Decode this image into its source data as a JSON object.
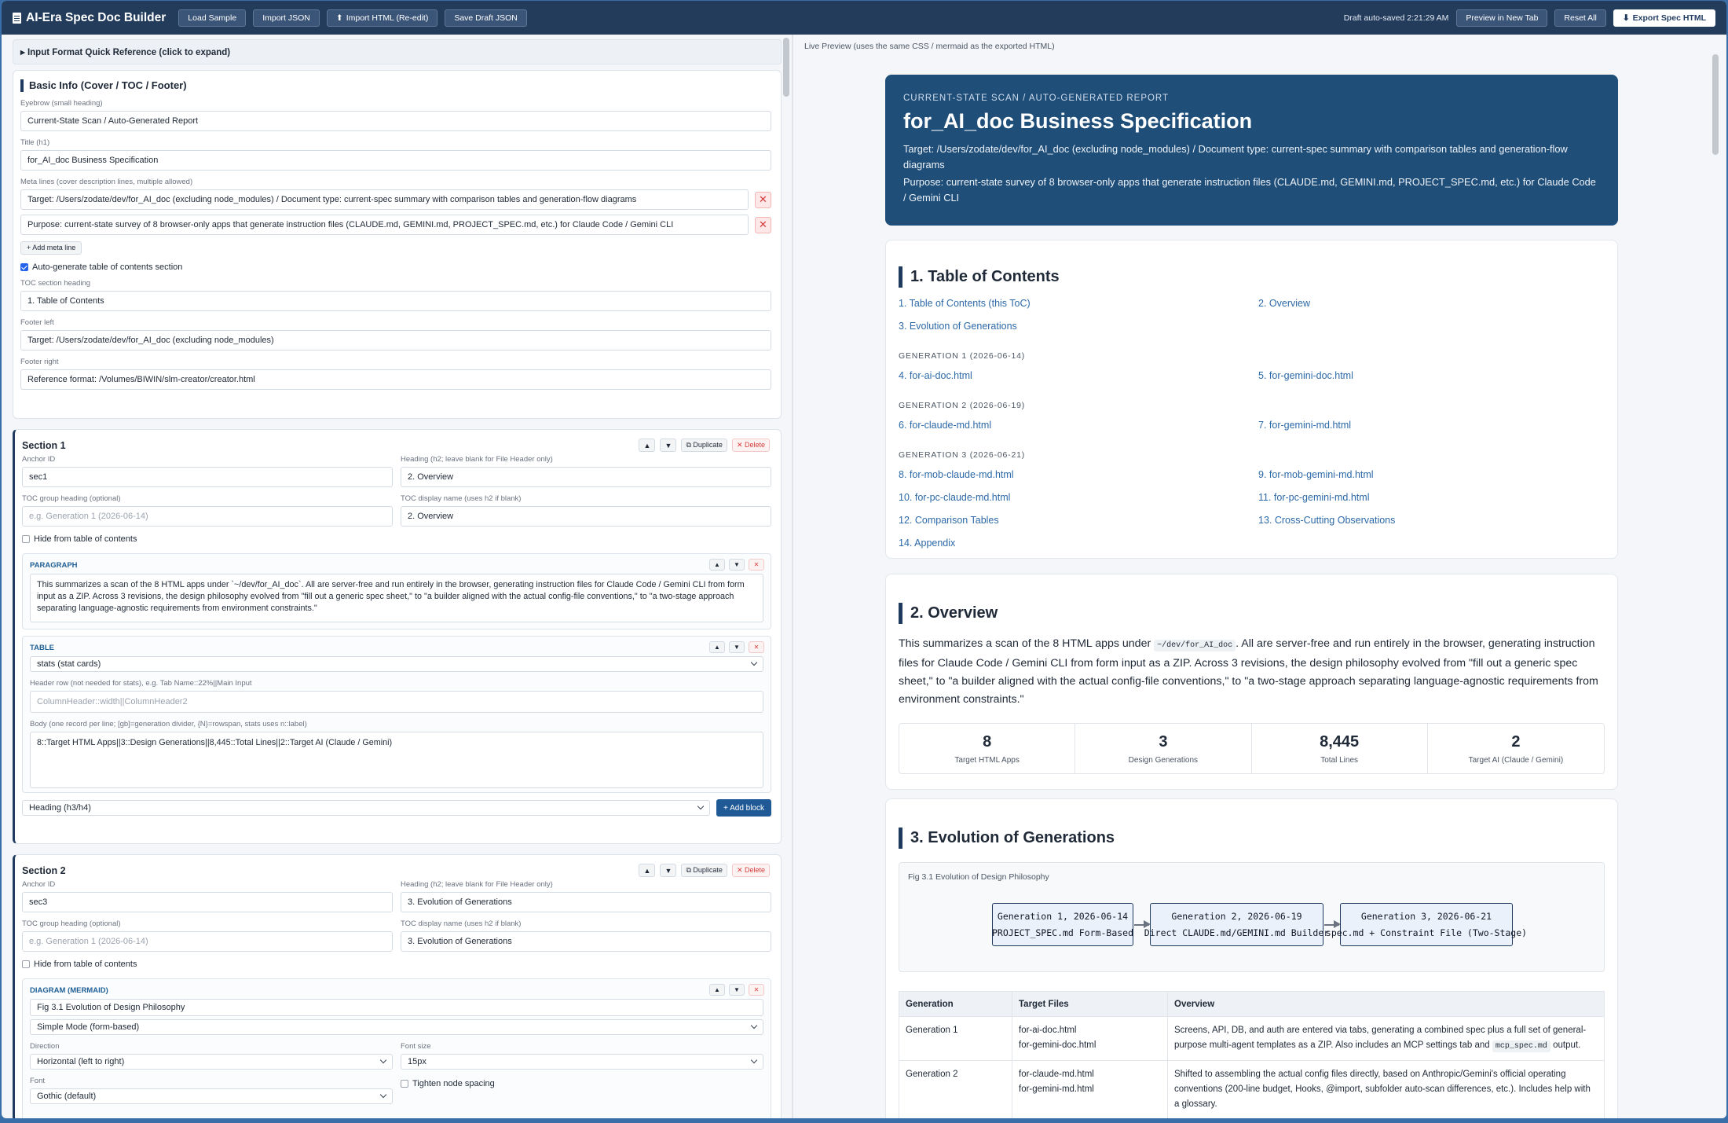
{
  "topbar": {
    "title": "AI-Era Spec Doc Builder",
    "buttons": [
      "Load Sample",
      "Import JSON",
      "Import HTML (Re-edit)",
      "Save Draft JSON"
    ],
    "saved": "Draft auto-saved 2:21:29 AM",
    "preview_tab": "Preview in New Tab",
    "reset": "Reset All",
    "export": "Export Spec HTML"
  },
  "editor": {
    "quick_ref": "▸ Input Format Quick Reference (click to expand)",
    "basic": {
      "title": "Basic Info (Cover / TOC / Footer)",
      "eyebrow_label": "Eyebrow (small heading)",
      "eyebrow": "Current-State Scan / Auto-Generated Report",
      "title_label": "Title (h1)",
      "title_value": "for_AI_doc Business Specification",
      "meta_label": "Meta lines (cover description lines, multiple allowed)",
      "meta": [
        "Target: /Users/zodate/dev/for_AI_doc (excluding node_modules) / Document type: current-spec summary with comparison tables and generation-flow diagrams",
        "Purpose: current-state survey of 8 browser-only apps that generate instruction files (CLAUDE.md, GEMINI.md, PROJECT_SPEC.md, etc.) for Claude Code / Gemini CLI"
      ],
      "add_meta": "+ Add meta line",
      "auto_toc": "Auto-generate table of contents section",
      "toc_heading_label": "TOC section heading",
      "toc_heading": "1. Table of Contents",
      "footer_left_label": "Footer left",
      "footer_left": "Target: /Users/zodate/dev/for_AI_doc (excluding node_modules)",
      "footer_right_label": "Footer right",
      "footer_right": "Reference format: /Volumes/BIWIN/slm-creator/creator.html"
    },
    "common": {
      "anchor_label": "Anchor ID",
      "heading_label": "Heading (h2; leave blank for File Header only)",
      "toc_group_label": "TOC group heading (optional)",
      "toc_group_ph": "e.g. Generation 1 (2026-06-14)",
      "toc_display_label": "TOC display name (uses h2 if blank)",
      "hide_toc": "Hide from table of contents",
      "duplicate": "⧉ Duplicate",
      "delete": "✕ Delete",
      "up": "▲",
      "down": "▼",
      "x": "✕",
      "add_block": "+ Add block",
      "block_type": "Heading (h3/h4)"
    },
    "s1": {
      "title": "Section 1",
      "anchor": "sec1",
      "heading": "2. Overview",
      "toc_display": "2. Overview",
      "p_label": "PARAGRAPH",
      "p_text": "This summarizes a scan of the 8 HTML apps under `~/dev/for_AI_doc`. All are server-free and run entirely in the browser, generating instruction files for Claude Code / Gemini CLI from form input as a ZIP. Across 3 revisions, the design philosophy evolved from \"fill out a generic spec sheet,\" to \"a builder aligned with the actual config-file conventions,\" to \"a two-stage approach separating language-agnostic requirements from environment constraints.\"",
      "t_label": "TABLE",
      "t_type": "stats (stat cards)",
      "header_label": "Header row (not needed for stats), e.g. Tab Name::22%||Main Input",
      "header_ph": "ColumnHeader::width||ColumnHeader2",
      "body_label": "Body (one record per line; [gb]=generation divider, {N}=rowspan, stats uses n::label)",
      "body_text": "8::Target HTML Apps||3::Design Generations||8,445::Total Lines||2::Target AI (Claude / Gemini)"
    },
    "s2": {
      "title": "Section 2",
      "anchor": "sec3",
      "heading": "3. Evolution of Generations",
      "toc_display": "3. Evolution of Generations",
      "d_label": "DIAGRAM (MERMAID)",
      "d_caption": "Fig 3.1 Evolution of Design Philosophy",
      "d_mode": "Simple Mode (form-based)",
      "dir_label": "Direction",
      "dir": "Horizontal (left to right)",
      "fs_label": "Font size",
      "fs": "15px",
      "font_label": "Font",
      "font": "Gothic (default)",
      "tighten": "Tighten node spacing"
    }
  },
  "preview": {
    "label": "Live Preview (uses the same CSS / mermaid as the exported HTML)",
    "hero": {
      "eyebrow": "CURRENT-STATE SCAN / AUTO-GENERATED REPORT",
      "title": "for_AI_doc Business Specification",
      "meta1": "Target: /Users/zodate/dev/for_AI_doc (excluding node_modules) / Document type: current-spec summary with comparison tables and generation-flow diagrams",
      "meta2": "Purpose: current-state survey of 8 browser-only apps that generate instruction files (CLAUDE.md, GEMINI.md, PROJECT_SPEC.md, etc.) for Claude Code / Gemini CLI"
    },
    "toc": {
      "title": "1. Table of Contents",
      "a1": "1. Table of Contents (this ToC)",
      "a2": "2. Overview",
      "a3": "3. Evolution of Generations",
      "g1": "GENERATION 1 (2026-06-14)",
      "a4": "4. for-ai-doc.html",
      "a5": "5. for-gemini-doc.html",
      "g2": "GENERATION 2 (2026-06-19)",
      "a6": "6. for-claude-md.html",
      "a7": "7. for-gemini-md.html",
      "g3": "GENERATION 3 (2026-06-21)",
      "a8": "8. for-mob-claude-md.html",
      "a9": "9. for-mob-gemini-md.html",
      "a10": "10. for-pc-claude-md.html",
      "a11": "11. for-pc-gemini-md.html",
      "a12": "12. Comparison Tables",
      "a13": "13. Cross-Cutting Observations",
      "a14": "14. Appendix"
    },
    "overview": {
      "title": "2. Overview",
      "p1": "This summarizes a scan of the 8 HTML apps under",
      "code": "~/dev/for_AI_doc",
      "p2": ". All are server-free and run entirely in the browser, generating instruction files for Claude Code / Gemini CLI from form input as a ZIP. Across 3 revisions, the design philosophy evolved from \"fill out a generic spec sheet,\" to \"a builder aligned with the actual config-file conventions,\" to \"a two-stage approach separating language-agnostic requirements from environment constraints.\"",
      "stats": [
        {
          "v": "8",
          "l": "Target HTML Apps"
        },
        {
          "v": "3",
          "l": "Design Generations"
        },
        {
          "v": "8,445",
          "l": "Total Lines"
        },
        {
          "v": "2",
          "l": "Target AI (Claude / Gemini)"
        }
      ]
    },
    "evolution": {
      "title": "3. Evolution of Generations",
      "fig_cap": "Fig 3.1 Evolution of Design Philosophy",
      "nodes": [
        [
          "Generation 1, 2026-06-14",
          "PROJECT_SPEC.md Form-Based"
        ],
        [
          "Generation 2, 2026-06-19",
          "Direct CLAUDE.md/GEMINI.md Builder"
        ],
        [
          "Generation 3, 2026-06-21",
          "spec.md + Constraint File (Two-Stage)"
        ]
      ],
      "th": [
        "Generation",
        "Target Files",
        "Overview"
      ],
      "r1": {
        "gen": "Generation 1",
        "f1": "for-ai-doc.html",
        "f2": "for-gemini-doc.html",
        "ov": "Screens, API, DB, and auth are entered via tabs, generating a combined spec plus a full set of general-purpose multi-agent templates as a ZIP. Also includes an MCP settings tab and",
        "code": "mcp_spec.md",
        "ov2": "output."
      },
      "r2": {
        "gen": "Generation 2",
        "f1": "for-claude-md.html",
        "f2": "for-gemini-md.html",
        "ov": "Shifted to assembling the actual config files directly, based on Anthropic/Gemini's official operating conventions (200-line budget, Hooks, @import, subfolder auto-scan differences, etc.). Includes help with a glossary."
      }
    }
  }
}
